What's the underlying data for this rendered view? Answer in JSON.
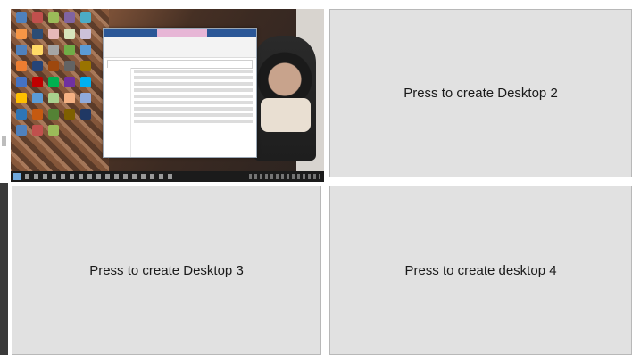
{
  "tiles": [
    {
      "id": "desktop-1",
      "label": ""
    },
    {
      "id": "desktop-2",
      "label": "Press to create Desktop 2"
    },
    {
      "id": "desktop-3",
      "label": "Press to create Desktop 3"
    },
    {
      "id": "desktop-4",
      "label": "Press to create desktop 4"
    }
  ],
  "colors": {
    "tile_background": "#e1e1e1",
    "tile_border": "#b8b8b8",
    "taskbar": "#1b1b1b",
    "explorer_titlebar": "#2b5797"
  }
}
